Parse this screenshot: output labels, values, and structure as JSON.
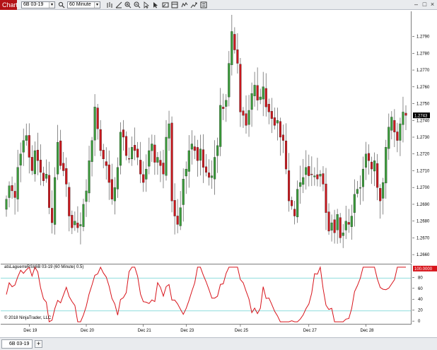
{
  "window": {
    "tab_label": "Chart",
    "instrument": "6B 03-19",
    "interval": "60 Minute"
  },
  "toolbar_icons": [
    "search-icon",
    "bar-style-icon",
    "drawing-tools-icon",
    "zoom-in-icon",
    "zoom-out-icon",
    "pointer-icon",
    "global-pointer-icon",
    "snapshot-icon",
    "templates-icon",
    "indicators-icon",
    "strategies-icon",
    "properties-icon"
  ],
  "window_buttons": [
    "minimize-icon",
    "maximize-icon",
    "close-icon"
  ],
  "indicator_label": "atsLaguerreRSI(6B 03-19 (60 Minute) 0.5)",
  "copyright": "© 2018 NinjaTrader, LLC",
  "price_last_label": "1.2743",
  "indicator_last_label": "100.0000",
  "bottom_tabs": {
    "sheet": "6B 03-19",
    "add": "+"
  },
  "colors": {
    "up": "#3a9a3a",
    "down": "#c8171d",
    "wick": "#5a5a5a",
    "indicator": "#d8141b",
    "levels": "#7fd8d8",
    "last_price_bg": "#000000",
    "indicator_last_bg": "#d8141b"
  },
  "chart_data": [
    {
      "type": "candlestick",
      "price_axis": {
        "ylim": [
          1.2655,
          1.2805
        ],
        "ticks": [
          "1.2660",
          "1.2670",
          "1.2680",
          "1.2690",
          "1.2700",
          "1.2710",
          "1.2720",
          "1.2730",
          "1.2740",
          "1.2750",
          "1.2760",
          "1.2770",
          "1.2780",
          "1.2790"
        ]
      },
      "x_ticks": [
        {
          "label": "Dec 19",
          "index": 8
        },
        {
          "label": "Dec 20",
          "index": 28
        },
        {
          "label": "Dec 21",
          "index": 48
        },
        {
          "label": "Dec 23",
          "index": 63
        },
        {
          "label": "Dec 25",
          "index": 82
        },
        {
          "label": "Dec 27",
          "index": 106
        },
        {
          "label": "Dec 28",
          "index": 126
        }
      ],
      "last_price": 1.2743,
      "closes": [
        1.2693,
        1.2701,
        1.2698,
        1.2694,
        1.2712,
        1.272,
        1.2728,
        1.2731,
        1.2718,
        1.271,
        1.2722,
        1.2716,
        1.2709,
        1.2704,
        1.2708,
        1.2688,
        1.2679,
        1.2706,
        1.2727,
        1.2713,
        1.271,
        1.2702,
        1.2683,
        1.2676,
        1.268,
        1.2676,
        1.2678,
        1.269,
        1.2698,
        1.2716,
        1.2728,
        1.2748,
        1.2735,
        1.2722,
        1.2717,
        1.2713,
        1.2703,
        1.2693,
        1.27,
        1.2712,
        1.2733,
        1.273,
        1.2719,
        1.2717,
        1.2724,
        1.2722,
        1.2718,
        1.2708,
        1.2703,
        1.2711,
        1.2722,
        1.2726,
        1.2715,
        1.2718,
        1.2713,
        1.2708,
        1.273,
        1.2738,
        1.2692,
        1.2683,
        1.2678,
        1.2688,
        1.2705,
        1.2711,
        1.2722,
        1.2726,
        1.2722,
        1.2716,
        1.2723,
        1.2712,
        1.2709,
        1.2706,
        1.2707,
        1.2718,
        1.2725,
        1.2749,
        1.2747,
        1.2752,
        1.2774,
        1.2793,
        1.2782,
        1.2774,
        1.2745,
        1.2743,
        1.2737,
        1.2746,
        1.2756,
        1.2761,
        1.2752,
        1.2754,
        1.276,
        1.2748,
        1.2745,
        1.2741,
        1.2737,
        1.274,
        1.273,
        1.2728,
        1.2711,
        1.2692,
        1.2689,
        1.2683,
        1.2699,
        1.2703,
        1.2706,
        1.2712,
        1.2707,
        1.2708,
        1.2707,
        1.2705,
        1.2708,
        1.2702,
        1.2685,
        1.2674,
        1.2679,
        1.2673,
        1.2684,
        1.267,
        1.2673,
        1.268,
        1.2678,
        1.2683,
        1.2696,
        1.2699,
        1.27,
        1.2711,
        1.272,
        1.2716,
        1.2711,
        1.2716,
        1.27,
        1.2692,
        1.2703,
        1.2724,
        1.2736,
        1.2742,
        1.2733,
        1.2728,
        1.2738,
        1.2745,
        1.2743
      ]
    },
    {
      "type": "line",
      "name": "atsLaguerreRSI(6B 03-19 (60 Minute) 0.5)",
      "ylim": [
        -5,
        105
      ],
      "ticks": [
        "0",
        "20",
        "40",
        "60",
        "80"
      ],
      "levels": [
        20,
        80
      ],
      "last_value": 100.0
    }
  ]
}
